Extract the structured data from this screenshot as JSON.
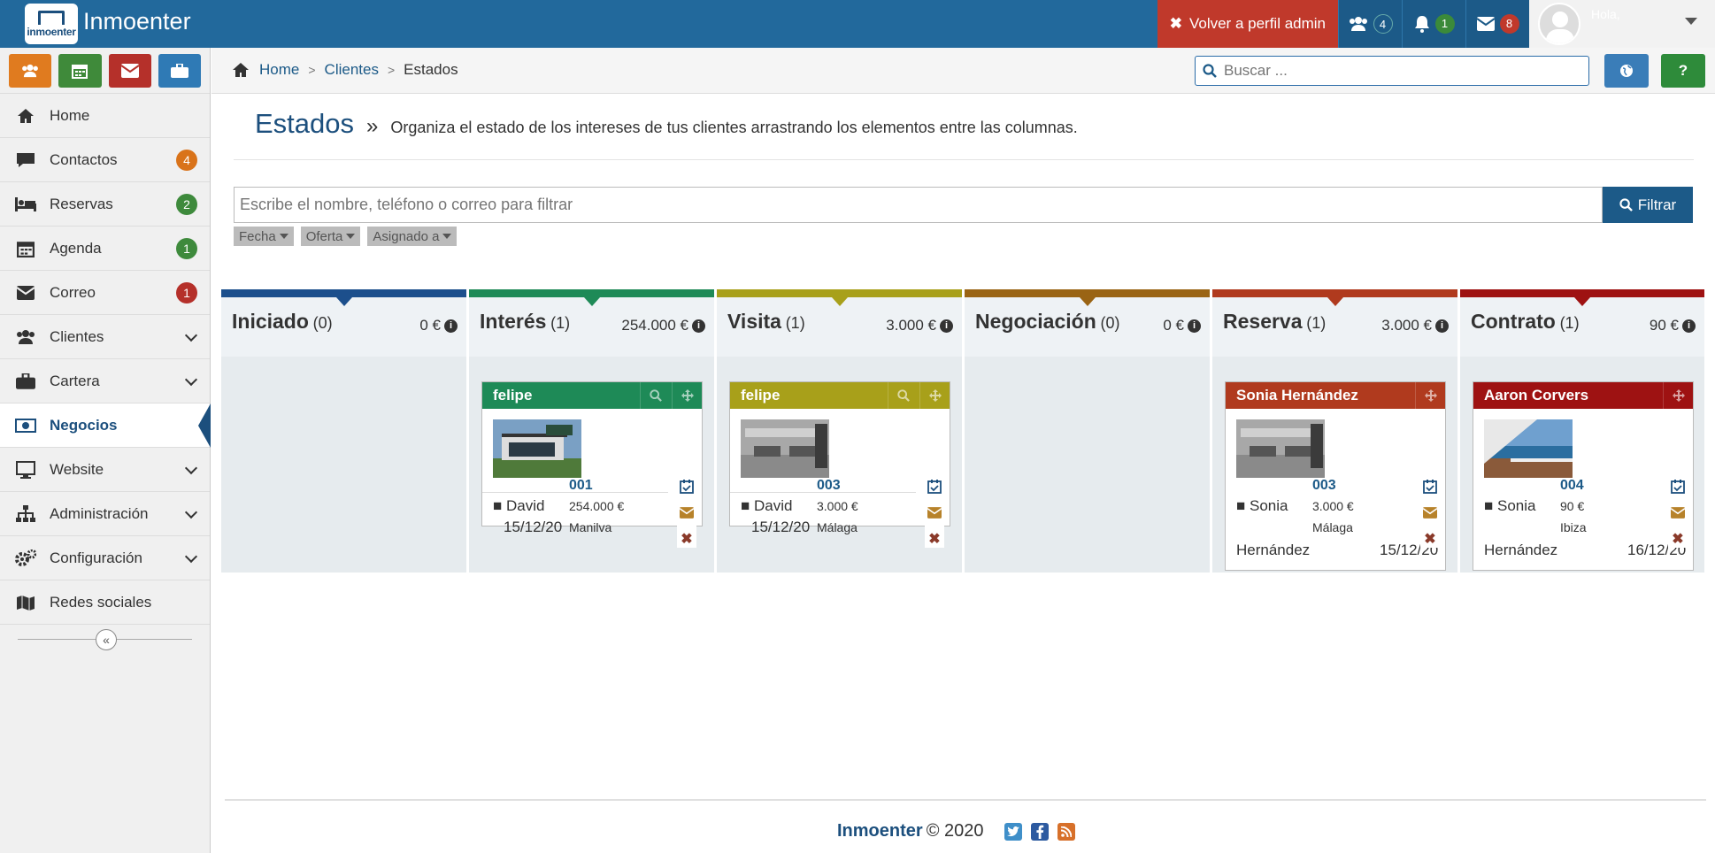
{
  "app": {
    "name": "Inmoenter",
    "logo_text": "inmoenter"
  },
  "topbar": {
    "admin_label": "Volver a perfil admin",
    "users_count": "4",
    "notif_count": "1",
    "mail_count": "8",
    "greeting": "Hola,"
  },
  "sidebar": {
    "items": [
      {
        "label": "Home"
      },
      {
        "label": "Contactos",
        "badge": "4"
      },
      {
        "label": "Reservas",
        "badge": "2"
      },
      {
        "label": "Agenda",
        "badge": "1"
      },
      {
        "label": "Correo",
        "badge": "1"
      },
      {
        "label": "Clientes"
      },
      {
        "label": "Cartera"
      },
      {
        "label": "Negocios"
      },
      {
        "label": "Website"
      },
      {
        "label": "Administración"
      },
      {
        "label": "Configuración"
      },
      {
        "label": "Redes sociales"
      }
    ],
    "collapse_glyph": "«"
  },
  "breadcrumb": {
    "home": "Home",
    "clientes": "Clientes",
    "current": "Estados"
  },
  "search": {
    "placeholder": "Buscar ..."
  },
  "page": {
    "title": "Estados",
    "sep": "»",
    "description": "Organiza el estado de los intereses de tus clientes arrastrando los elementos entre las columnas."
  },
  "filter": {
    "placeholder": "Escribe el nombre, teléfono o correo para filtrar",
    "button": "Filtrar",
    "chips": [
      "Fecha",
      "Oferta",
      "Asignado a"
    ]
  },
  "columns": [
    {
      "name": "Iniciado",
      "count": "(0)",
      "total": "0 €",
      "color": "#1c4f8c"
    },
    {
      "name": "Interés",
      "count": "(1)",
      "total": "254.000 €",
      "color": "#1e8a57"
    },
    {
      "name": "Visita",
      "count": "(1)",
      "total": "3.000 €",
      "color": "#a8a01a"
    },
    {
      "name": "Negociación",
      "count": "(0)",
      "total": "0 €",
      "color": "#9a6414"
    },
    {
      "name": "Reserva",
      "count": "(1)",
      "total": "3.000 €",
      "color": "#b03a1e"
    },
    {
      "name": "Contrato",
      "count": "(1)",
      "total": "90 €",
      "color": "#9e1212"
    }
  ],
  "cards": [
    {
      "title": "felipe",
      "ref": "001",
      "price": "254.000 €",
      "place": "Manilva",
      "user": "David",
      "date": "15/12/20",
      "color": "#1e8a57"
    },
    {
      "title": "felipe",
      "ref": "003",
      "price": "3.000 €",
      "place": "Málaga",
      "user": "David",
      "date": "15/12/20",
      "color": "#a8a01a"
    },
    {
      "title": "Sonia Hernández",
      "ref": "003",
      "price": "3.000 €",
      "place": "Málaga",
      "user": "Sonia",
      "user2": "Hernández",
      "date": "15/12/20",
      "color": "#b03a1e"
    },
    {
      "title": "Aaron Corvers",
      "ref": "004",
      "price": "90 €",
      "place": "Ibiza",
      "user": "Sonia",
      "user2": "Hernández",
      "date": "16/12/20",
      "color": "#9e1212"
    }
  ],
  "footer": {
    "brand": "Inmoenter",
    "copy": "© 2020"
  }
}
